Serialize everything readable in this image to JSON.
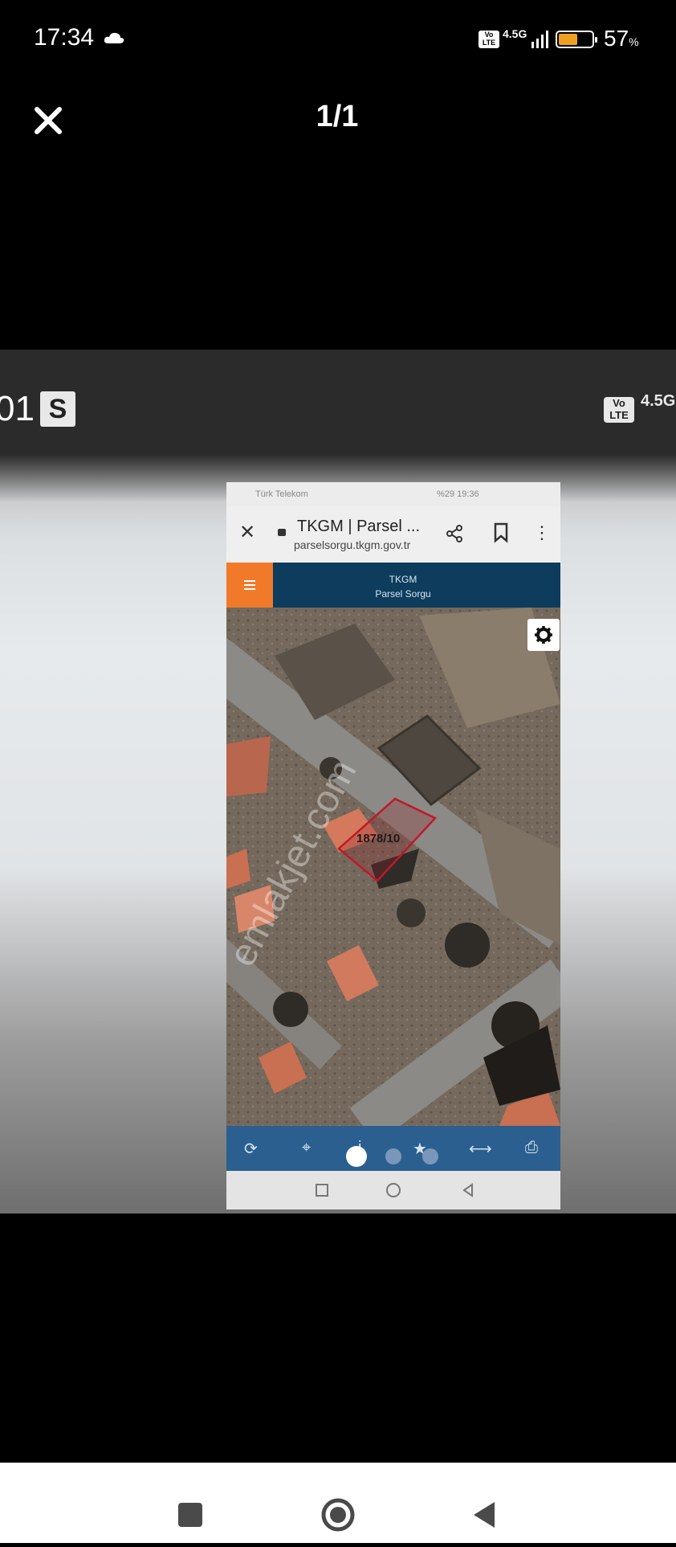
{
  "status_bar": {
    "time": "17:34",
    "volte": "Vo\nLTE",
    "network": "4.5G",
    "battery_percent": "57",
    "battery_unit": "%",
    "battery_level": 0.57
  },
  "viewer": {
    "counter": "1/1"
  },
  "embedded_screenshot": {
    "left_partial_text": "01",
    "s_badge": "S",
    "right_volte": "Vo\nLTE",
    "right_network": "4.5G",
    "phone": {
      "status_right": "%29 19:36",
      "status_carrier": "Türk Telekom",
      "tab_title": "TKGM | Parsel ...",
      "url": "parselsorgu.tkgm.gov.tr",
      "header_brand_line1": "TKGM",
      "header_brand_line2": "Parsel Sorgu",
      "parcel_label": "1878/10",
      "watermark": "emlakjet.com"
    }
  },
  "pager": {
    "total": 3,
    "active": 0
  },
  "colors": {
    "accent_orange": "#f07a2a",
    "header_navy": "#0d3c5d",
    "toolbar_blue": "#2a5f90",
    "parcel_red": "#c0182a"
  }
}
